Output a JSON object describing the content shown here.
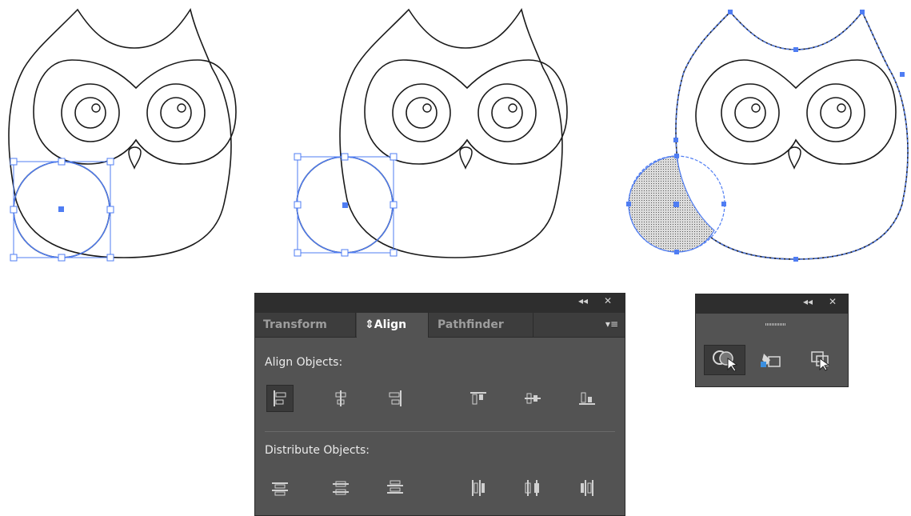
{
  "colors": {
    "selection": "#4f7df3",
    "panel_bg": "#535353",
    "panel_title_bg": "#2e2e2e",
    "tab_strip_bg": "#3d3d3d",
    "outline": "#1a1a1a"
  },
  "align_panel": {
    "collapse_label": "◂◂",
    "close_label": "✕",
    "tabs": [
      {
        "label": "Transform",
        "active": false
      },
      {
        "label": "⇕Align",
        "active": true
      },
      {
        "label": "Pathfinder",
        "active": false
      }
    ],
    "menu_label": "▾≡",
    "align_objects_label": "Align Objects:",
    "distribute_objects_label": "Distribute Objects:",
    "align_buttons": [
      {
        "icon": "horizontal-align-left-icon",
        "selected": true
      },
      {
        "icon": "horizontal-align-center-icon",
        "selected": false
      },
      {
        "icon": "horizontal-align-right-icon",
        "selected": false
      },
      {
        "icon": "vertical-align-top-icon",
        "selected": false
      },
      {
        "icon": "vertical-align-center-icon",
        "selected": false
      },
      {
        "icon": "vertical-align-bottom-icon",
        "selected": false
      }
    ],
    "distribute_buttons": [
      {
        "icon": "vertical-distribute-top-icon"
      },
      {
        "icon": "vertical-distribute-center-icon"
      },
      {
        "icon": "vertical-distribute-bottom-icon"
      },
      {
        "icon": "horizontal-distribute-left-icon"
      },
      {
        "icon": "horizontal-distribute-center-icon"
      },
      {
        "icon": "horizontal-distribute-right-icon"
      }
    ]
  },
  "tools_panel": {
    "collapse_label": "◂◂",
    "close_label": "✕",
    "tools": [
      {
        "icon": "shape-builder-icon",
        "selected": true
      },
      {
        "icon": "live-paint-bucket-icon",
        "selected": false
      },
      {
        "icon": "live-paint-selection-icon",
        "selected": false
      }
    ]
  }
}
